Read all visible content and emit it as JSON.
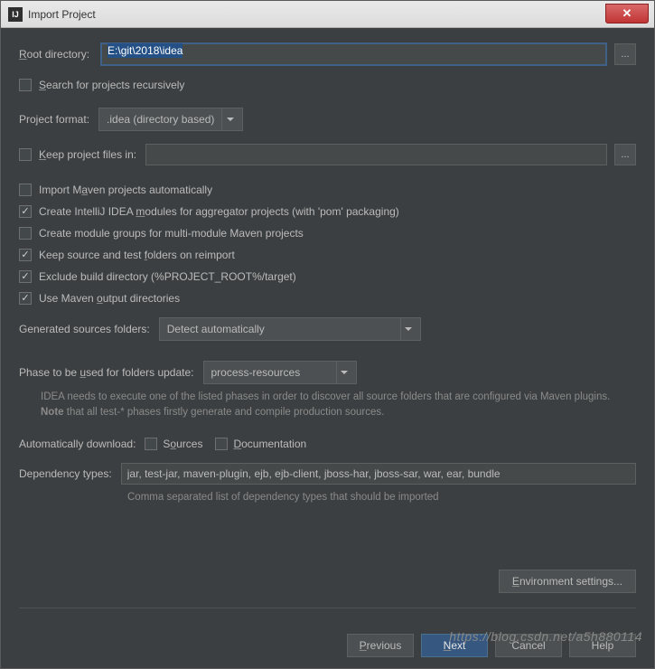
{
  "title": "Import Project",
  "root_dir_label": "Root directory:",
  "root_dir_value": "E:\\git\\2018\\idea",
  "browse": "...",
  "search_recursively": "Search for projects recursively",
  "project_format_label": "Project format:",
  "project_format_value": ".idea (directory based)",
  "keep_files_label": "Keep project files in:",
  "opts": {
    "import_auto": "Import Maven projects automatically",
    "create_modules": "Create IntelliJ IDEA modules for aggregator projects (with 'pom' packaging)",
    "create_groups": "Create module groups for multi-module Maven projects",
    "keep_source": "Keep source and test folders on reimport",
    "exclude_build": "Exclude build directory (%PROJECT_ROOT%/target)",
    "use_maven_out": "Use Maven output directories"
  },
  "gen_sources_label": "Generated sources folders:",
  "gen_sources_value": "Detect automatically",
  "phase_label": "Phase to be used for folders update:",
  "phase_value": "process-resources",
  "phase_hint1": "IDEA needs to execute one of the listed phases in order to discover all source folders that are configured via Maven plugins.",
  "phase_hint_note": "Note",
  "phase_hint2": " that all test-* phases firstly generate and compile production sources.",
  "auto_dl_label": "Automatically download:",
  "auto_dl_sources": "Sources",
  "auto_dl_docs": "Documentation",
  "dep_types_label": "Dependency types:",
  "dep_types_value": "jar, test-jar, maven-plugin, ejb, ejb-client, jboss-har, jboss-sar, war, ear, bundle",
  "dep_types_hint": "Comma separated list of dependency types that should be imported",
  "env_settings": "Environment settings...",
  "buttons": {
    "previous": "Previous",
    "next": "Next",
    "cancel": "Cancel",
    "help": "Help"
  },
  "watermark": "https://blog.csdn.net/a5h880114"
}
